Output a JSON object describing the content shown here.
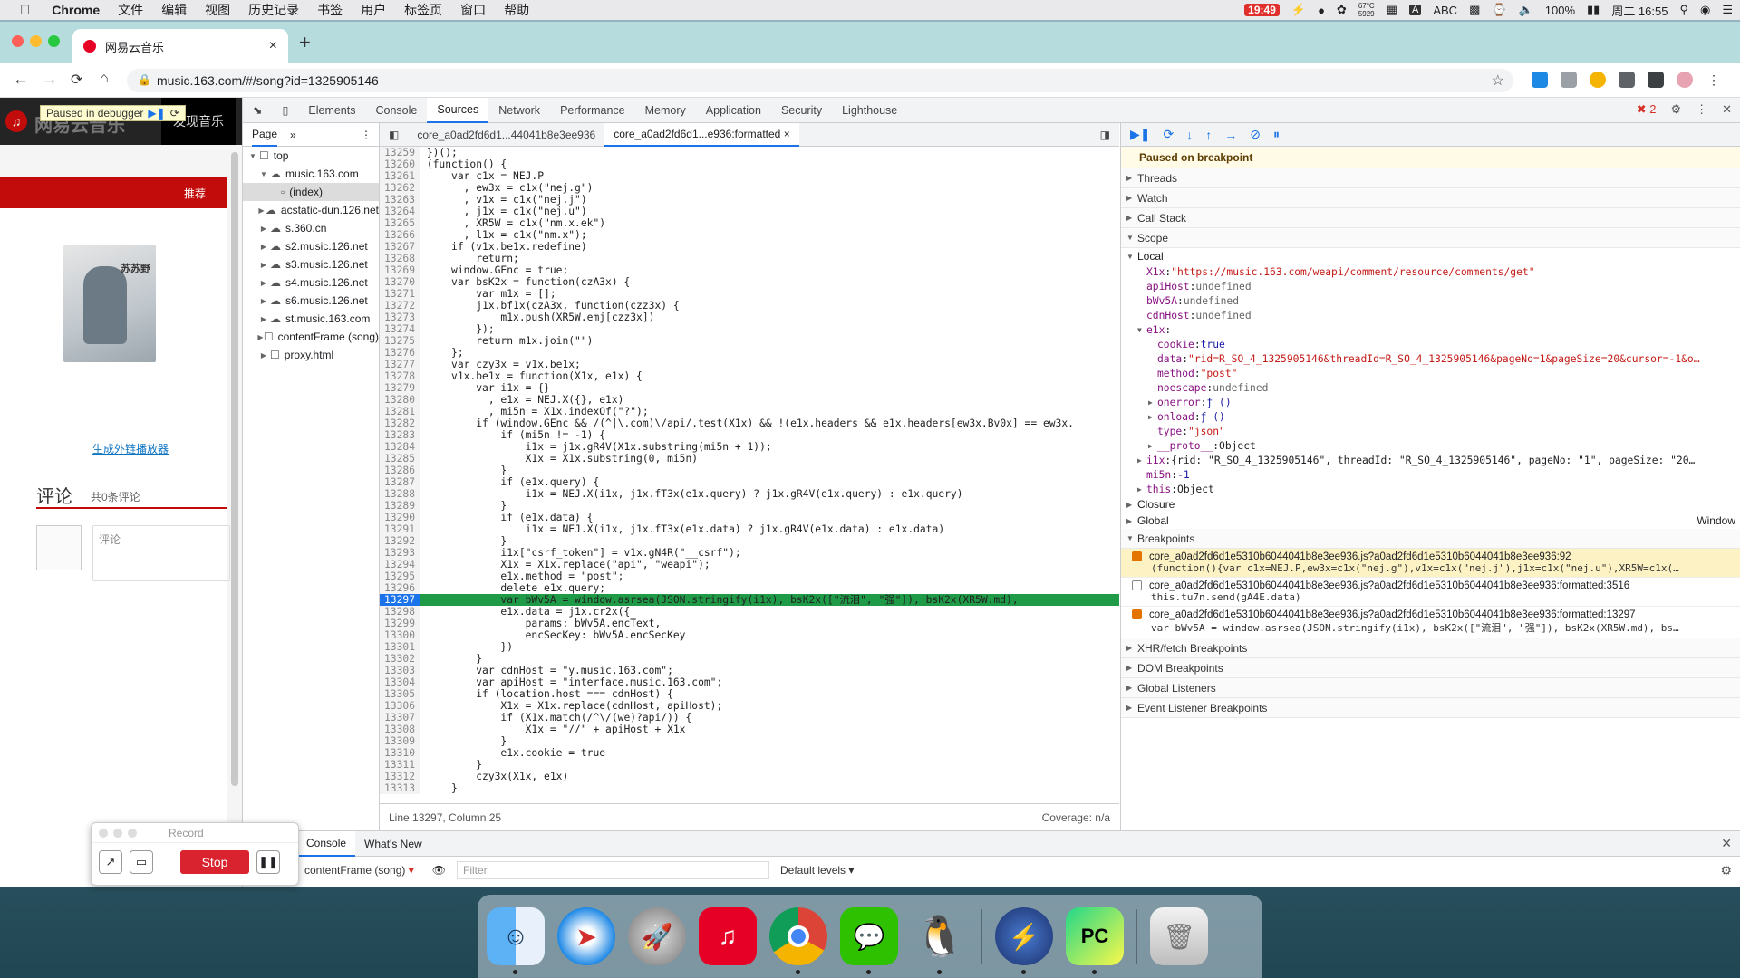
{
  "menubar": {
    "apple": "",
    "app_name": "Chrome",
    "menus": [
      "文件",
      "编辑",
      "视图",
      "历史记录",
      "书签",
      "用户",
      "标签页",
      "窗口",
      "帮助"
    ],
    "status": {
      "record_time": "19:49",
      "weather_top": "67°C",
      "weather_bottom": "5929",
      "input": "ABC",
      "battery": "100%",
      "datetime": "周二 16:55"
    }
  },
  "browser": {
    "tab_title": "网易云音乐",
    "url": "music.163.com/#/song?id=1325905146"
  },
  "page": {
    "logo_text": "网易云音乐",
    "discover": "发现音乐",
    "debugger_pill": "Paused in debugger",
    "recommend": "推荐",
    "album_text": "苏苏野",
    "gen_link": "生成外链播放器",
    "comments_title": "评论",
    "comments_count": "共0条评论",
    "comment_placeholder": "评论"
  },
  "devtools": {
    "tabs": [
      "Elements",
      "Console",
      "Sources",
      "Network",
      "Performance",
      "Memory",
      "Application",
      "Security",
      "Lighthouse"
    ],
    "active_tab": "Sources",
    "error_count": "2",
    "navigator": {
      "tab_page": "Page",
      "tab_more": "»",
      "tree": [
        {
          "label": "top",
          "indent": 0,
          "arrow": "▼",
          "icon": "☐"
        },
        {
          "label": "music.163.com",
          "indent": 1,
          "arrow": "▼",
          "icon": "☁"
        },
        {
          "label": "(index)",
          "indent": 2,
          "arrow": "",
          "icon": "▫",
          "selected": true
        },
        {
          "label": "acstatic-dun.126.net",
          "indent": 1,
          "arrow": "▶",
          "icon": "☁"
        },
        {
          "label": "s.360.cn",
          "indent": 1,
          "arrow": "▶",
          "icon": "☁"
        },
        {
          "label": "s2.music.126.net",
          "indent": 1,
          "arrow": "▶",
          "icon": "☁"
        },
        {
          "label": "s3.music.126.net",
          "indent": 1,
          "arrow": "▶",
          "icon": "☁"
        },
        {
          "label": "s4.music.126.net",
          "indent": 1,
          "arrow": "▶",
          "icon": "☁"
        },
        {
          "label": "s6.music.126.net",
          "indent": 1,
          "arrow": "▶",
          "icon": "☁"
        },
        {
          "label": "st.music.163.com",
          "indent": 1,
          "arrow": "▶",
          "icon": "☁"
        },
        {
          "label": "contentFrame (song)",
          "indent": 1,
          "arrow": "▶",
          "icon": "☐"
        },
        {
          "label": "proxy.html",
          "indent": 1,
          "arrow": "▶",
          "icon": "☐"
        }
      ]
    },
    "editor": {
      "tabs": [
        "core_a0ad2fd6d1...44041b8e3ee936",
        "core_a0ad2fd6d1...e936:formatted"
      ],
      "active_tab_index": 1,
      "highlight_line": "13297",
      "lines": [
        {
          "n": "13259",
          "t": "})();"
        },
        {
          "n": "13260",
          "t": "(function() {"
        },
        {
          "n": "13261",
          "t": "    var c1x = NEJ.P"
        },
        {
          "n": "13262",
          "t": "      , ew3x = c1x(\"nej.g\")"
        },
        {
          "n": "13263",
          "t": "      , v1x = c1x(\"nej.j\")"
        },
        {
          "n": "13264",
          "t": "      , j1x = c1x(\"nej.u\")"
        },
        {
          "n": "13265",
          "t": "      , XR5W = c1x(\"nm.x.ek\")"
        },
        {
          "n": "13266",
          "t": "      , l1x = c1x(\"nm.x\");"
        },
        {
          "n": "13267",
          "t": "    if (v1x.be1x.redefine)"
        },
        {
          "n": "13268",
          "t": "        return;"
        },
        {
          "n": "13269",
          "t": "    window.GEnc = true;"
        },
        {
          "n": "13270",
          "t": "    var bsK2x = function(czA3x) {"
        },
        {
          "n": "13271",
          "t": "        var m1x = [];"
        },
        {
          "n": "13272",
          "t": "        j1x.bf1x(czA3x, function(czz3x) {"
        },
        {
          "n": "13273",
          "t": "            m1x.push(XR5W.emj[czz3x])"
        },
        {
          "n": "13274",
          "t": "        });"
        },
        {
          "n": "13275",
          "t": "        return m1x.join(\"\")"
        },
        {
          "n": "13276",
          "t": "    };"
        },
        {
          "n": "13277",
          "t": "    var czy3x = v1x.be1x;"
        },
        {
          "n": "13278",
          "t": "    v1x.be1x = function(X1x, e1x) {"
        },
        {
          "n": "13279",
          "t": "        var i1x = {}"
        },
        {
          "n": "13280",
          "t": "          , e1x = NEJ.X({}, e1x)"
        },
        {
          "n": "13281",
          "t": "          , mi5n = X1x.indexOf(\"?\");"
        },
        {
          "n": "13282",
          "t": "        if (window.GEnc && /(^|\\.com)\\/api/.test(X1x) && !(e1x.headers && e1x.headers[ew3x.Bv0x] == ew3x."
        },
        {
          "n": "13283",
          "t": "            if (mi5n != -1) {"
        },
        {
          "n": "13284",
          "t": "                i1x = j1x.gR4V(X1x.substring(mi5n + 1));"
        },
        {
          "n": "13285",
          "t": "                X1x = X1x.substring(0, mi5n)"
        },
        {
          "n": "13286",
          "t": "            }"
        },
        {
          "n": "13287",
          "t": "            if (e1x.query) {"
        },
        {
          "n": "13288",
          "t": "                i1x = NEJ.X(i1x, j1x.fT3x(e1x.query) ? j1x.gR4V(e1x.query) : e1x.query)"
        },
        {
          "n": "13289",
          "t": "            }"
        },
        {
          "n": "13290",
          "t": "            if (e1x.data) {"
        },
        {
          "n": "13291",
          "t": "                i1x = NEJ.X(i1x, j1x.fT3x(e1x.data) ? j1x.gR4V(e1x.data) : e1x.data)"
        },
        {
          "n": "13292",
          "t": "            }"
        },
        {
          "n": "13293",
          "t": "            i1x[\"csrf_token\"] = v1x.gN4R(\"__csrf\");"
        },
        {
          "n": "13294",
          "t": "            X1x = X1x.replace(\"api\", \"weapi\");"
        },
        {
          "n": "13295",
          "t": "            e1x.method = \"post\";"
        },
        {
          "n": "13296",
          "t": "            delete e1x.query;"
        },
        {
          "n": "13297",
          "t": "            var bWv5A = window.asrsea(JSON.stringify(i1x), bsK2x([\"流泪\", \"强\"]), bsK2x(XR5W.md), "
        },
        {
          "n": "13298",
          "t": "            e1x.data = j1x.cr2x({"
        },
        {
          "n": "13299",
          "t": "                params: bWv5A.encText,"
        },
        {
          "n": "13300",
          "t": "                encSecKey: bWv5A.encSecKey"
        },
        {
          "n": "13301",
          "t": "            })"
        },
        {
          "n": "13302",
          "t": "        }"
        },
        {
          "n": "13303",
          "t": "        var cdnHost = \"y.music.163.com\";"
        },
        {
          "n": "13304",
          "t": "        var apiHost = \"interface.music.163.com\";"
        },
        {
          "n": "13305",
          "t": "        if (location.host === cdnHost) {"
        },
        {
          "n": "13306",
          "t": "            X1x = X1x.replace(cdnHost, apiHost);"
        },
        {
          "n": "13307",
          "t": "            if (X1x.match(/^\\/(we)?api/)) {"
        },
        {
          "n": "13308",
          "t": "                X1x = \"//\" + apiHost + X1x"
        },
        {
          "n": "13309",
          "t": "            }"
        },
        {
          "n": "13310",
          "t": "            e1x.cookie = true"
        },
        {
          "n": "13311",
          "t": "        }"
        },
        {
          "n": "13312",
          "t": "        czy3x(X1x, e1x)"
        },
        {
          "n": "13313",
          "t": "    }"
        }
      ],
      "status_position": "Line 13297, Column 25",
      "status_coverage": "Coverage: n/a"
    },
    "debugger": {
      "paused_text": "Paused on breakpoint",
      "sections_top": [
        "Threads",
        "Watch",
        "Call Stack"
      ],
      "scope_label": "Scope",
      "local_label": "Local",
      "scope_rows": [
        {
          "indent": 1,
          "arrow": "",
          "key": "X1x",
          "value": "\"https://music.163.com/weapi/comment/resource/comments/get\"",
          "kind": "s"
        },
        {
          "indent": 1,
          "arrow": "",
          "key": "apiHost",
          "value": "undefined",
          "kind": "u"
        },
        {
          "indent": 1,
          "arrow": "",
          "key": "bWv5A",
          "value": "undefined",
          "kind": "u"
        },
        {
          "indent": 1,
          "arrow": "",
          "key": "cdnHost",
          "value": "undefined",
          "kind": "u"
        },
        {
          "indent": 1,
          "arrow": "▼",
          "key": "e1x",
          "value": "",
          "kind": "o"
        },
        {
          "indent": 2,
          "arrow": "",
          "key": "cookie",
          "value": "true",
          "kind": "v"
        },
        {
          "indent": 2,
          "arrow": "",
          "key": "data",
          "value": "\"rid=R_SO_4_1325905146&threadId=R_SO_4_1325905146&pageNo=1&pageSize=20&cursor=-1&o…",
          "kind": "s"
        },
        {
          "indent": 2,
          "arrow": "",
          "key": "method",
          "value": "\"post\"",
          "kind": "s"
        },
        {
          "indent": 2,
          "arrow": "",
          "key": "noescape",
          "value": "undefined",
          "kind": "u"
        },
        {
          "indent": 2,
          "arrow": "▶",
          "key": "onerror",
          "value": "ƒ ()",
          "kind": "v"
        },
        {
          "indent": 2,
          "arrow": "▶",
          "key": "onload",
          "value": "ƒ ()",
          "kind": "v"
        },
        {
          "indent": 2,
          "arrow": "",
          "key": "type",
          "value": "\"json\"",
          "kind": "s"
        },
        {
          "indent": 2,
          "arrow": "▶",
          "key": "__proto__",
          "value": "Object",
          "kind": "o"
        },
        {
          "indent": 1,
          "arrow": "▶",
          "key": "i1x",
          "value": "{rid: \"R_SO_4_1325905146\", threadId: \"R_SO_4_1325905146\", pageNo: \"1\", pageSize: \"20…",
          "kind": "o"
        },
        {
          "indent": 1,
          "arrow": "",
          "key": "mi5n",
          "value": "-1",
          "kind": "v"
        },
        {
          "indent": 1,
          "arrow": "▶",
          "key": "this",
          "value": "Object",
          "kind": "o"
        }
      ],
      "closure_label": "Closure",
      "global_label": "Global",
      "global_value": "Window",
      "breakpoints_label": "Breakpoints",
      "breakpoints": [
        {
          "file": "core_a0ad2fd6d1e5310b6044041b8e3ee936.js?a0ad2fd6d1e5310b6044041b8e3ee936:92",
          "code": "(function(){var c1x=NEJ.P,ew3x=c1x(\"nej.g\"),v1x=c1x(\"nej.j\"),j1x=c1x(\"nej.u\"),XR5W=c1x(…",
          "checked": true,
          "active": true
        },
        {
          "file": "core_a0ad2fd6d1e5310b6044041b8e3ee936.js?a0ad2fd6d1e5310b6044041b8e3ee936:formatted:3516",
          "code": "this.tu7n.send(gA4E.data)",
          "checked": false,
          "active": false
        },
        {
          "file": "core_a0ad2fd6d1e5310b6044041b8e3ee936.js?a0ad2fd6d1e5310b6044041b8e3ee936:formatted:13297",
          "code": "var bWv5A = window.asrsea(JSON.stringify(i1x), bsK2x([\"流泪\", \"强\"]), bsK2x(XR5W.md), bs…",
          "checked": true,
          "active": false
        }
      ],
      "sections_bottom": [
        "XHR/fetch Breakpoints",
        "DOM Breakpoints",
        "Global Listeners",
        "Event Listener Breakpoints"
      ]
    },
    "drawer": {
      "tabs": [
        "Console",
        "What's New"
      ],
      "context": "contentFrame (song)",
      "filter_placeholder": "Filter",
      "levels": "Default levels ▾"
    }
  },
  "record_widget": {
    "title": "Record",
    "stop": "Stop"
  },
  "dock": {
    "apps": [
      "finder-icon",
      "safari-icon",
      "launchpad-icon",
      "netease-music-icon",
      "chrome-icon",
      "wechat-icon",
      "qq-icon",
      "thunder-icon",
      "pycharm-icon",
      "trash-icon"
    ]
  }
}
